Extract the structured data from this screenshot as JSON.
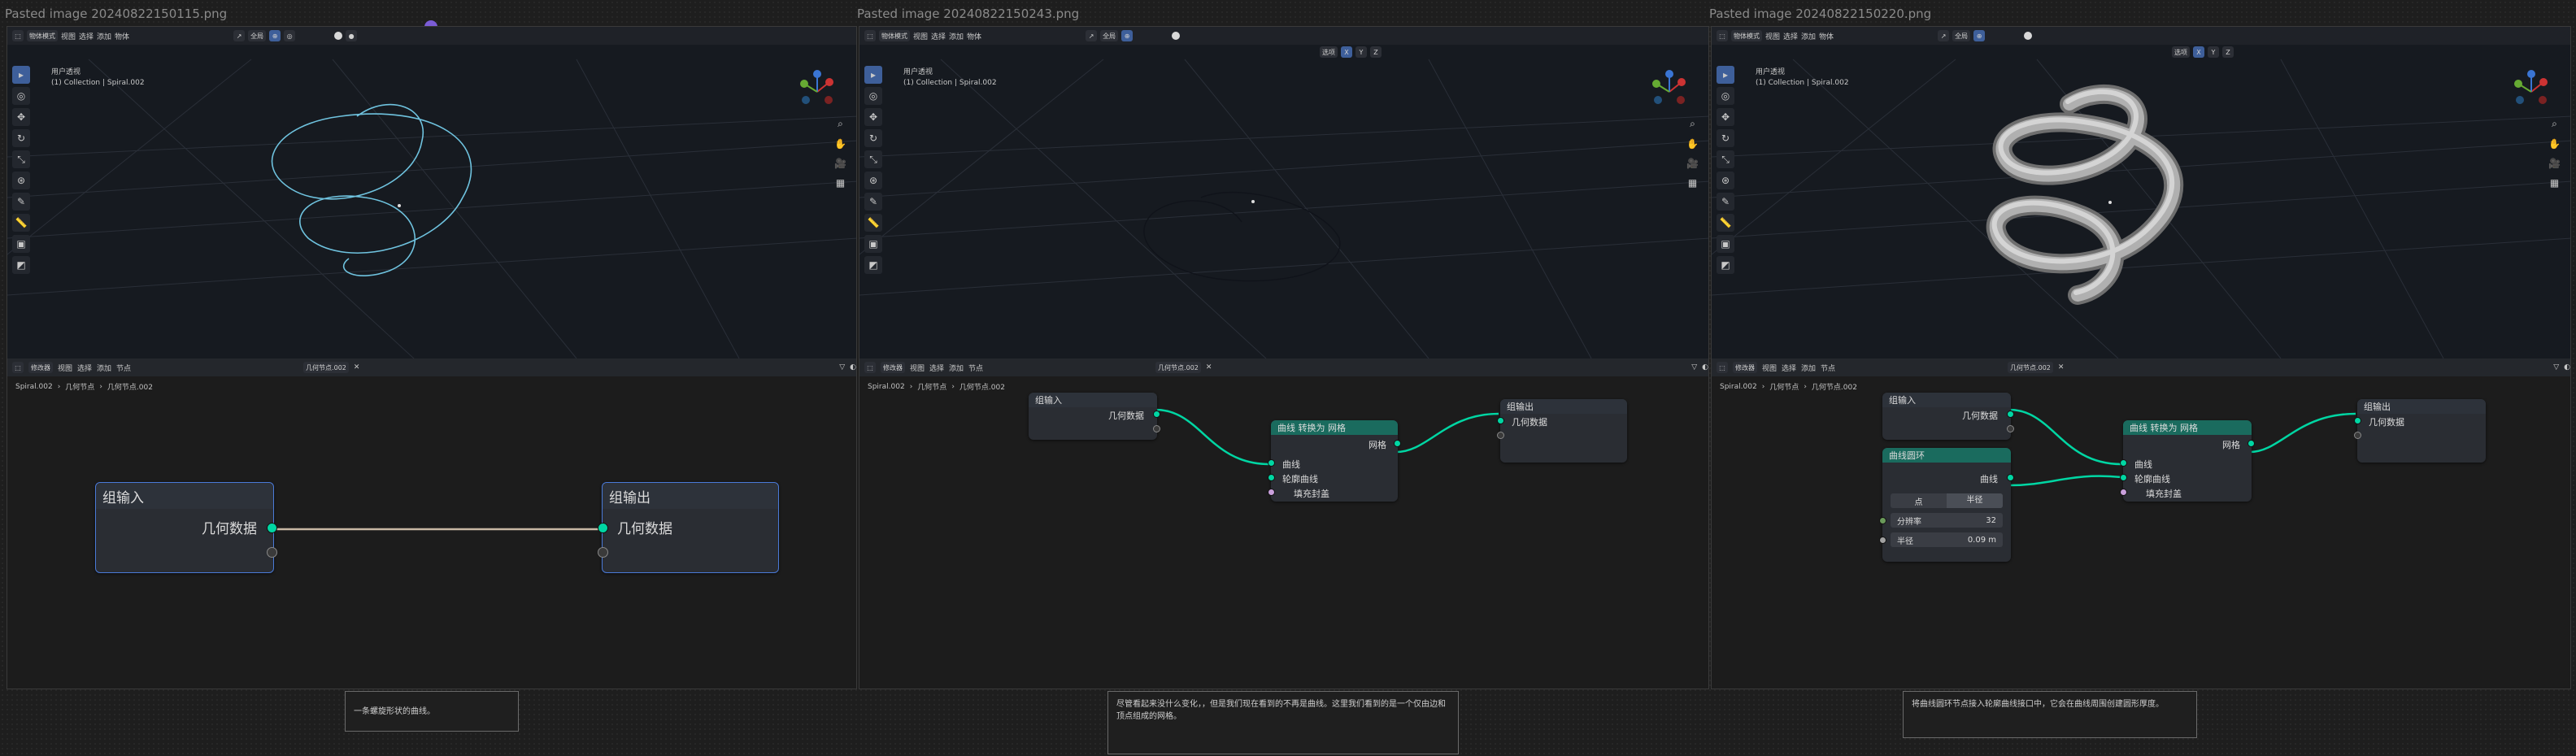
{
  "panels": [
    {
      "title": "Pasted image 20240822150115.png",
      "vp": {
        "mode": "物体模式",
        "menus": [
          "视图",
          "选择",
          "添加",
          "物体"
        ],
        "shading": "全局",
        "persp": "用户透视",
        "collection": "(1) Collection | Spiral.002"
      },
      "ne": {
        "editor": "修改器",
        "menus": [
          "视图",
          "选择",
          "添加",
          "节点"
        ],
        "nodegroup": "几何节点.002",
        "crumbs": [
          "Spiral.002",
          "几何节点",
          "几何节点.002"
        ]
      },
      "caption": "一条螺旋形状的曲线。"
    },
    {
      "title": "Pasted image 20240822150243.png",
      "vp": {
        "mode": "物体模式",
        "menus": [
          "视图",
          "选择",
          "添加",
          "物体"
        ],
        "shading": "全局",
        "persp": "用户透视",
        "collection": "(1) Collection | Spiral.002"
      },
      "ne": {
        "editor": "修改器",
        "menus": [
          "视图",
          "选择",
          "添加",
          "节点"
        ],
        "nodegroup": "几何节点.002",
        "crumbs": [
          "Spiral.002",
          "几何节点",
          "几何节点.002"
        ]
      },
      "caption": "尽管看起来没什么变化，，但是我们现在看到的不再是曲线。这里我们看到的是一个仅由边和顶点组成的网格。"
    },
    {
      "title": "Pasted image 20240822150220.png",
      "vp": {
        "mode": "物体模式",
        "menus": [
          "视图",
          "选择",
          "添加",
          "物体"
        ],
        "shading": "全局",
        "persp": "用户透视",
        "collection": "(1) Collection | Spiral.002"
      },
      "ne": {
        "editor": "修改器",
        "menus": [
          "视图",
          "选择",
          "添加",
          "节点"
        ],
        "nodegroup": "几何节点.002",
        "crumbs": [
          "Spiral.002",
          "几何节点",
          "几何节点.002"
        ]
      },
      "caption": "将曲线圆环节点接入轮廓曲线接口中，它会在曲线周围创建圆形厚度。"
    }
  ],
  "select_label": "选项",
  "axes": [
    "X",
    "Y",
    "Z"
  ],
  "nodes": {
    "group_input": "组输入",
    "group_output": "组输出",
    "geometry": "几何数据",
    "curve_to_mesh": "曲线 转换为 网格",
    "mesh": "网格",
    "curve": "曲线",
    "profile": "轮廓曲线",
    "fill_caps": "填充封盖",
    "curve_circle": "曲线圆环",
    "mode_points": "点",
    "mode_radius": "半径",
    "resolution_label": "分辨率",
    "resolution_value": "32",
    "radius_label": "半径",
    "radius_value": "0.09 m"
  },
  "colors": {
    "geo_socket": "#00d6a3",
    "accent": "#3e5f9a",
    "circle_dot": "#7b5cd6"
  }
}
